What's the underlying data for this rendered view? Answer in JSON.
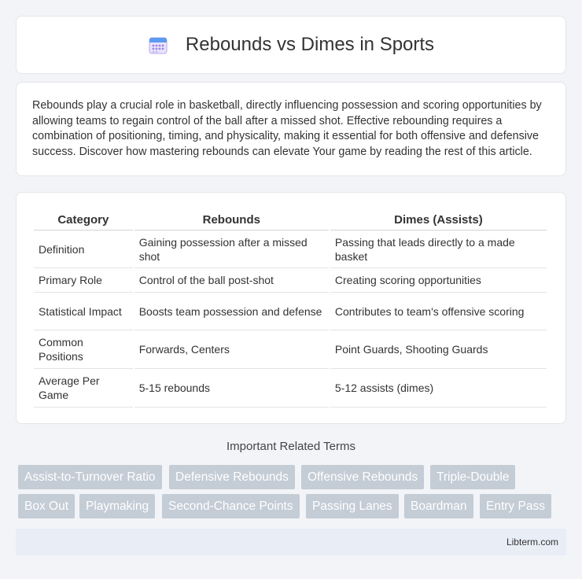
{
  "header": {
    "title": "Rebounds vs Dimes in Sports",
    "icon": "calendar-icon"
  },
  "intro": {
    "text": "Rebounds play a crucial role in basketball, directly influencing possession and scoring opportunities by allowing teams to regain control of the ball after a missed shot. Effective rebounding requires a combination of positioning, timing, and physicality, making it essential for both offensive and defensive success. Discover how mastering rebounds can elevate Your game by reading the rest of this article."
  },
  "table": {
    "headers": [
      "Category",
      "Rebounds",
      "Dimes (Assists)"
    ],
    "rows": [
      [
        "Definition",
        "Gaining possession after a missed shot",
        "Passing that leads directly to a made basket"
      ],
      [
        "Primary Role",
        "Control of the ball post-shot",
        "Creating scoring opportunities"
      ],
      [
        "Statistical Impact",
        "Boosts team possession and defense",
        "Contributes to team's offensive scoring"
      ],
      [
        "Common Positions",
        "Forwards, Centers",
        "Point Guards, Shooting Guards"
      ],
      [
        "Average Per Game",
        "5-15 rebounds",
        "5-12 assists (dimes)"
      ]
    ]
  },
  "related": {
    "title": "Important Related Terms",
    "tags": [
      "Assist-to-Turnover Ratio",
      "Defensive Rebounds",
      "Offensive Rebounds",
      "Triple-Double",
      "Box Out",
      "Playmaking",
      "Second-Chance Points",
      "Passing Lanes",
      "Boardman",
      "Entry Pass"
    ]
  },
  "footer": {
    "site": "Libterm.com"
  },
  "colors": {
    "background": "#f2f4f7",
    "tag_bg": "#c4ccd6",
    "footer_bg": "#e8edf6"
  }
}
